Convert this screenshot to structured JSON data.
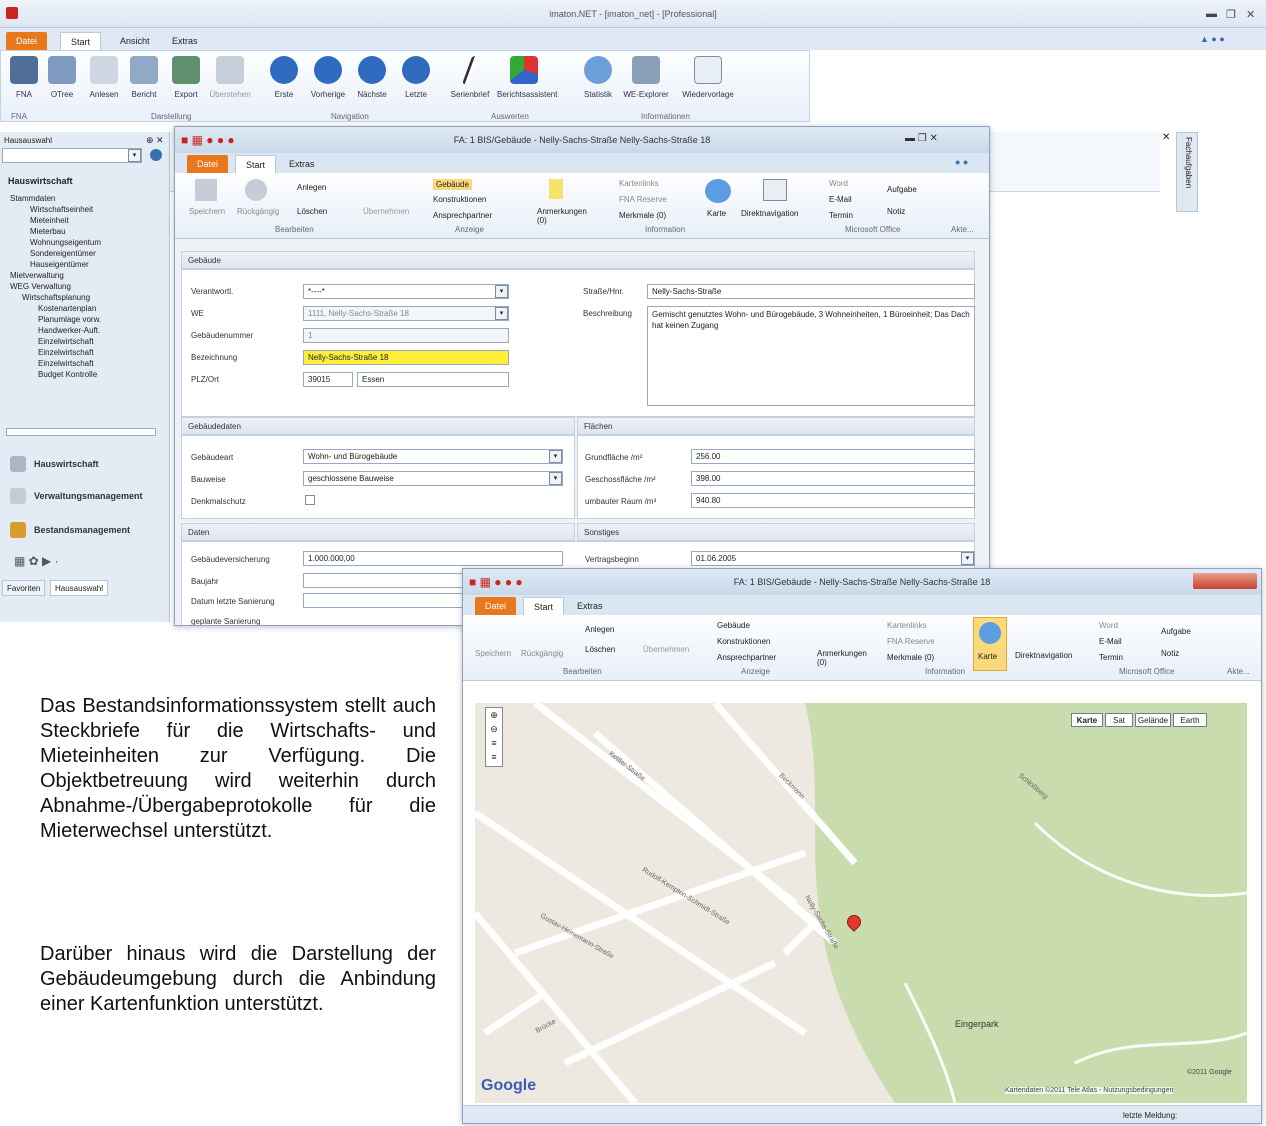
{
  "app": {
    "title": "imaton.NET - [imaton_net] - [Professional]"
  },
  "main_tabs": [
    "Datei",
    "Start",
    "Ansicht",
    "Extras"
  ],
  "ribbon": {
    "buttons": [
      "FNA",
      "OTree",
      "Anlesen",
      "Bericht",
      "Export",
      "Überstehen",
      "Erste",
      "Vorherige",
      "Nächste",
      "Letzte",
      "Serienbrief",
      "Berichtsassistent",
      "Statistik",
      "WE-Explorer",
      "Wiedervorlage"
    ],
    "groups": [
      "FNA",
      "Darstellung",
      "Navigation",
      "Auswerten",
      "Informationen"
    ]
  },
  "left_panel": {
    "title": "Hausauswahl",
    "section": "Hauswirtschaft",
    "tree": [
      "Stammdaten",
      "Wirtschaftseinheit",
      "Mieteinheit",
      "Mieterbau",
      "Wohnungseigentum",
      "Sondereigentümer",
      "Hauseigentümer",
      "Mietverwaltung",
      "WEG Verwaltung",
      "Wirtschaftsplanung",
      "Kostenartenplan",
      "Planumlage vorw.",
      "Handwerker-Auft.",
      "Einzelwirtschaft",
      "Einzelwirtschaft",
      "Einzelwirtschaft",
      "Budget Kontrolle"
    ],
    "nav": [
      "Hauswirtschaft",
      "Verwaltungsmanagement",
      "Bestandsmanagement"
    ],
    "bottom_tabs": [
      "Favoriten",
      "Hausauswahl"
    ],
    "right_strip": "Fachaufgaben"
  },
  "win1": {
    "title": "FA: 1 BIS/Gebäude - Nelly-Sachs-Straße Nelly-Sachs-Straße 18",
    "tabs": [
      "Datei",
      "Start",
      "Extras"
    ],
    "ribbon": {
      "buttons": [
        "Speichern",
        "Rückgängig",
        "Anlegen",
        "Löschen",
        "Übernehmen",
        "Gebäude",
        "Konstruktionen",
        "Ansprechpartner",
        "Anmerkungen (0)",
        "Kartenlinks",
        "FNA Reserve",
        "Merkmale (0)",
        "Karte",
        "Direktnavigation",
        "Word",
        "E-Mail",
        "Termin",
        "Aufgabe",
        "Notiz"
      ],
      "groups": [
        "Bearbeiten",
        "Anzeige",
        "Information",
        "Microsoft Office",
        "Akte..."
      ]
    },
    "sec_gebaeude": "Gebäude",
    "labels": [
      "Verantwortl.",
      "WE",
      "Gebäudenummer",
      "Bezeichnung",
      "PLZ/Ort",
      "Straße/Hnr.",
      "Beschreibung"
    ],
    "values": {
      "verantwortl": "*----*",
      "we": "1111, Nelly-Sachs-Straße 18",
      "geb_nr": "1",
      "bezeichnung": "Nelly-Sachs-Straße 18",
      "plz": "39015",
      "ort": "Essen",
      "strasse": "Nelly-Sachs-Straße",
      "beschreibung": "Gemischt genutztes Wohn- und Bürogebäude, 3 Wohneinheiten, 1 Büroeinheit; Das Dach hat keinen Zugang"
    },
    "sec_daten": "Gebäudedaten",
    "daten_labels": [
      "Gebäudeart",
      "Bauweise",
      "Denkmalschutz"
    ],
    "daten_values": [
      "Wohn- und Bürogebäude",
      "geschlossene Bauweise"
    ],
    "sec_flaechen": "Flächen",
    "flaechen_labels": [
      "Grundfläche /m²",
      "Geschossfläche /m²",
      "umbauter Raum /m³"
    ],
    "flaechen_values": [
      "256.00",
      "398.00",
      "940.80"
    ],
    "sec_daten2": "Daten",
    "daten2_labels": [
      "Gebäudeversicherung",
      "Baujahr",
      "Datum letzte Sanierung",
      "geplante Sanierung"
    ],
    "daten2_values": [
      "1.000.000,00"
    ],
    "sec_sonstiges": "Sonstiges",
    "sonst_labels": [
      "Vertragsbeginn"
    ],
    "sonst_values": [
      "01.06.2005"
    ]
  },
  "win2": {
    "title": "FA: 1 BIS/Gebäude - Nelly-Sachs-Straße Nelly-Sachs-Straße 18",
    "map_types": [
      "Karte",
      "Sat",
      "Gelände",
      "Earth"
    ],
    "streets": [
      "Rudolf-Kempten-Schmidt-Straße",
      "Gustav-Heinemann-Straße",
      "Nelly-Sachs-Straße",
      "Kettler-Straße",
      "Schloßberg",
      "Beckmann",
      "Brücke"
    ],
    "park": "Eingerpark",
    "attribution": "Kartendaten ©2011 Tele Atlas - Nutzungsbedingungen",
    "copyright": "©2011 Google",
    "logo": "Google",
    "status": "letzte Meldung:"
  },
  "text": {
    "p1": "Das Bestandsinformationssystem stellt auch Steckbriefe für die Wirtschafts- und Mieteinheiten zur Verfügung. Die Objektbetreuung wird weiterhin durch Abnahme-/Übergabeprotokolle für die Mieterwechsel unterstützt.",
    "p2": "Darüber hinaus wird die Darstellung der Gebäudeumgebung durch die Anbindung einer Kartenfunktion unterstützt."
  },
  "colors": {
    "accent": "#e9771b",
    "ribbon": "#e9f0f9",
    "highlight": "#ffef3a",
    "map_park": "#c8dcae",
    "map_land": "#ede8e0"
  }
}
